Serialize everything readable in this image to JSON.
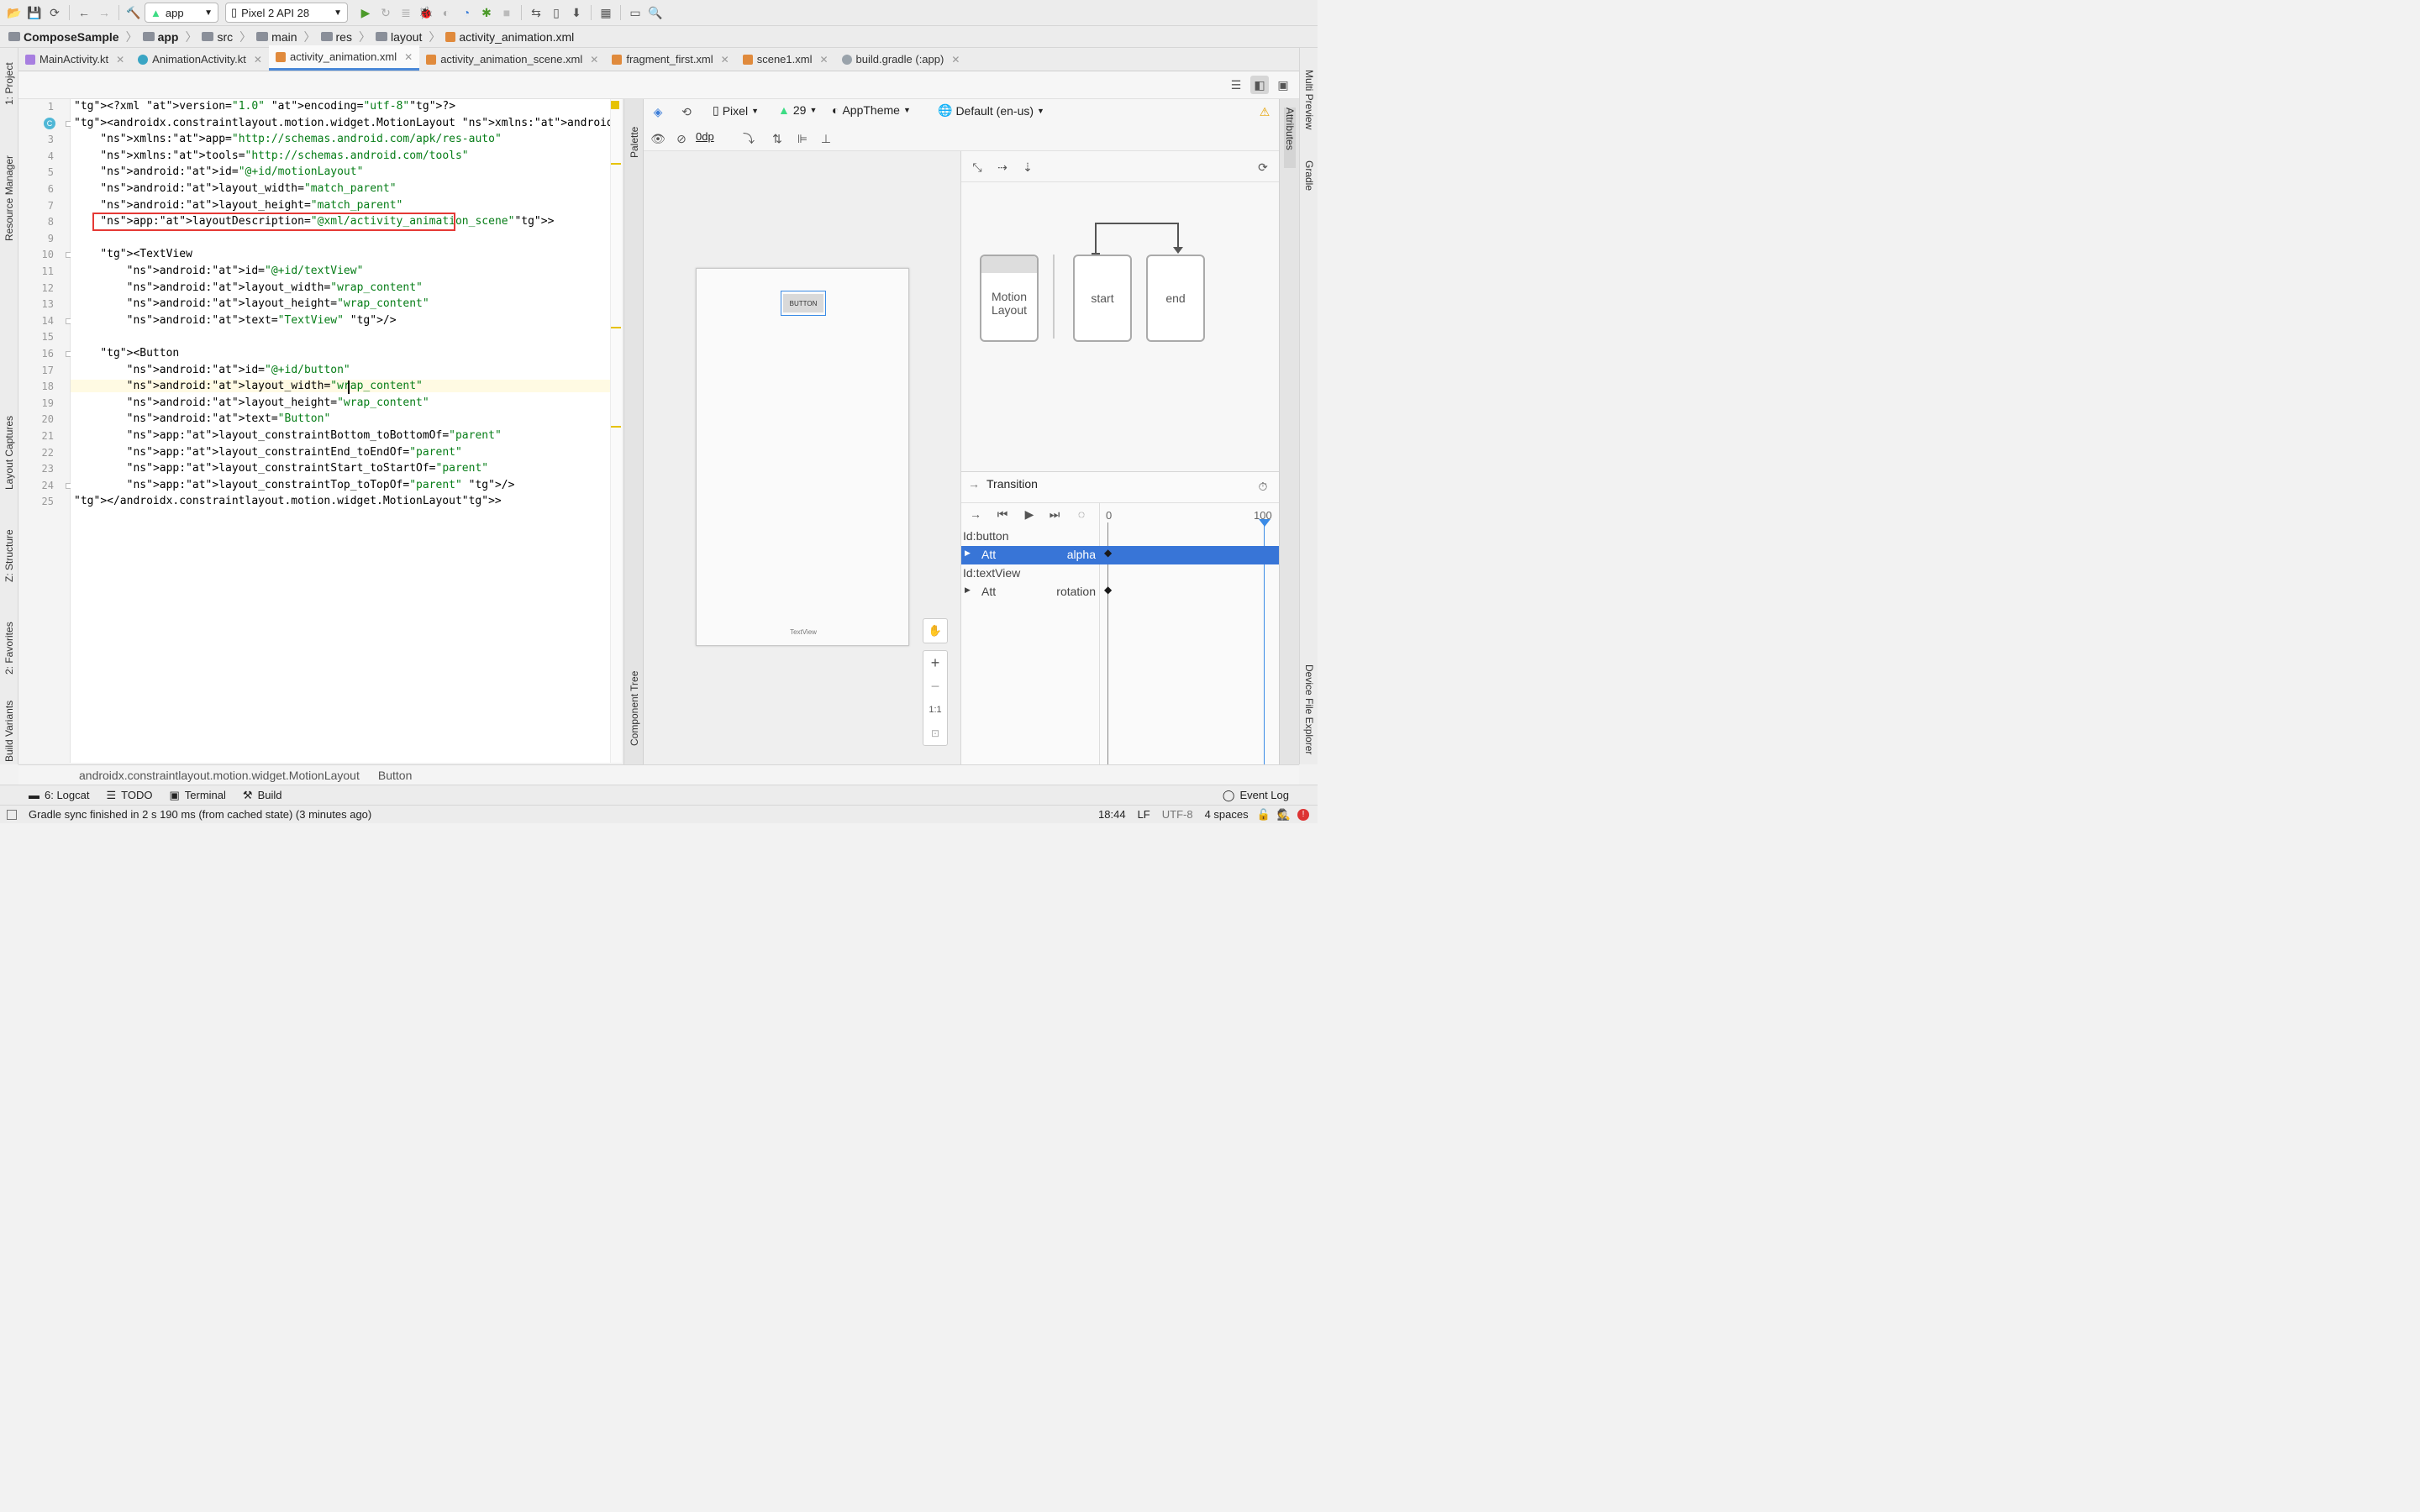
{
  "toolbar": {
    "config": "app",
    "device": "Pixel 2 API 28"
  },
  "breadcrumb": {
    "items": [
      "ComposeSample",
      "app",
      "src",
      "main",
      "res",
      "layout",
      "activity_animation.xml"
    ]
  },
  "tabs": [
    {
      "label": "MainActivity.kt"
    },
    {
      "label": "AnimationActivity.kt"
    },
    {
      "label": "activity_animation.xml"
    },
    {
      "label": "activity_animation_scene.xml"
    },
    {
      "label": "fragment_first.xml"
    },
    {
      "label": "scene1.xml"
    },
    {
      "label": "build.gradle (:app)"
    }
  ],
  "left_strip": {
    "project": "1: Project",
    "resource_manager": "Resource Manager",
    "layout_captures": "Layout Captures",
    "structure": "Z: Structure",
    "favorites": "2: Favorites",
    "build_variants": "Build Variants"
  },
  "right_strip": {
    "multi_preview": "Multi Preview",
    "gradle": "Gradle",
    "device_file_explorer": "Device File Explorer"
  },
  "code_lines": [
    "<?xml version=\"1.0\" encoding=\"utf-8\"?>",
    "<androidx.constraintlayout.motion.widget.MotionLayout xmlns:android=\"http://schemas.an",
    "    xmlns:app=\"http://schemas.android.com/apk/res-auto\"",
    "    xmlns:tools=\"http://schemas.android.com/tools\"",
    "    android:id=\"@+id/motionLayout\"",
    "    android:layout_width=\"match_parent\"",
    "    android:layout_height=\"match_parent\"",
    "    app:layoutDescription=\"@xml/activity_animation_scene\">",
    "",
    "    <TextView",
    "        android:id=\"@+id/textView\"",
    "        android:layout_width=\"wrap_content\"",
    "        android:layout_height=\"wrap_content\"",
    "        android:text=\"TextView\" />",
    "",
    "    <Button",
    "        android:id=\"@+id/button\"",
    "        android:layout_width=\"wrap_content\"",
    "        android:layout_height=\"wrap_content\"",
    "        android:text=\"Button\"",
    "        app:layout_constraintBottom_toBottomOf=\"parent\"",
    "        app:layout_constraintEnd_toEndOf=\"parent\"",
    "        app:layout_constraintStart_toStartOf=\"parent\"",
    "        app:layout_constraintTop_toTopOf=\"parent\" />",
    "</androidx.constraintlayout.motion.widget.MotionLayout>"
  ],
  "line_numbers": [
    "1",
    "2",
    "3",
    "4",
    "5",
    "6",
    "7",
    "8",
    "9",
    "10",
    "11",
    "12",
    "13",
    "14",
    "15",
    "16",
    "17",
    "18",
    "19",
    "20",
    "21",
    "22",
    "23",
    "24",
    "25"
  ],
  "design": {
    "palette_label": "Palette",
    "component_tree_label": "Component Tree",
    "attributes_label": "Attributes",
    "device": "Pixel",
    "api": "29",
    "theme": "AppTheme",
    "locale": "Default (en-us)",
    "margin": "0dp",
    "preview_button": "BUTTON",
    "preview_textview": "TextView",
    "zoom_ratio": "1:1"
  },
  "motion": {
    "layout_box": "Motion Layout",
    "start": "start",
    "end": "end"
  },
  "transition": {
    "title": "Transition",
    "tick_start": "0",
    "tick_end": "100",
    "rows": [
      {
        "id": "Id:button",
        "att": "Att",
        "prop": "alpha"
      },
      {
        "id": "Id:textView",
        "att": "Att",
        "prop": "rotation"
      }
    ]
  },
  "pathbar": [
    "androidx.constraintlayout.motion.widget.MotionLayout",
    "Button"
  ],
  "bottom_tabs": {
    "logcat": "6: Logcat",
    "todo": "TODO",
    "terminal": "Terminal",
    "build": "Build",
    "event_log": "Event Log"
  },
  "status": {
    "message": "Gradle sync finished in 2 s 190 ms (from cached state) (3 minutes ago)",
    "time": "18:44",
    "line_sep": "LF",
    "encoding": "UTF-8",
    "indent": "4 spaces"
  },
  "colors": {
    "accent": "#4a88d8",
    "selection": "#3875d7",
    "highlight_box": "#e53935"
  }
}
